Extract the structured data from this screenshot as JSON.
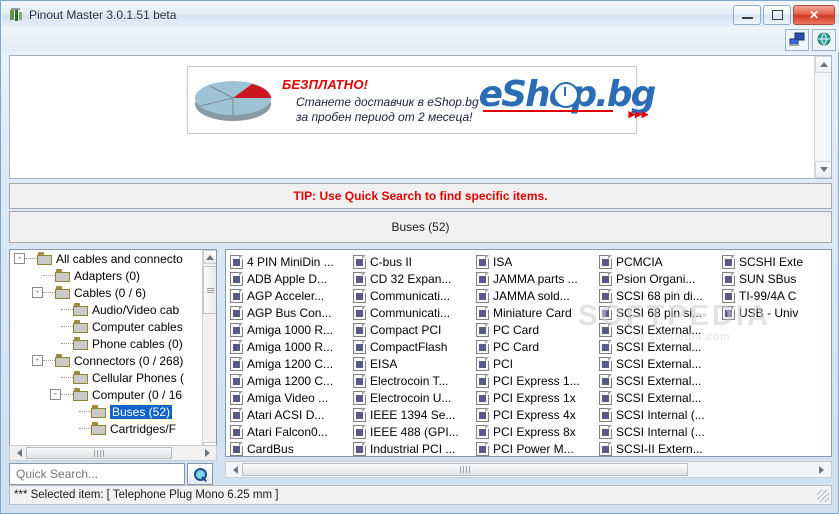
{
  "window": {
    "title": "Pinout Master 3.0.1.51 beta",
    "app_icon": "pinout-master-icon",
    "buttons": {
      "minimize": "—",
      "maximize": "□",
      "close": "✕"
    }
  },
  "toolbar": {
    "items": [
      {
        "icon": "network-screen-icon",
        "label": ""
      },
      {
        "icon": "globe-icon",
        "label": ""
      }
    ]
  },
  "banner": {
    "free_label": "БЕЗПЛАТНО!",
    "line1": "Станете доставчик в eShop.bg",
    "line2": "за пробен период от 2 месеца!",
    "logo_text": "eShop.bg",
    "arrow": "▸▸▸",
    "pie_icon": "pie-chart-icon"
  },
  "tip": {
    "text": "TIP: Use Quick Search to find specific items."
  },
  "header": {
    "title": "Buses (52)"
  },
  "tree": {
    "items": [
      {
        "label": "All cables and connecto",
        "indent": 0,
        "toggle": "-",
        "selected": false
      },
      {
        "label": "Adapters (0)",
        "indent": 1,
        "toggle": "",
        "selected": false
      },
      {
        "label": "Cables (0 / 6)",
        "indent": 1,
        "toggle": "-",
        "selected": false
      },
      {
        "label": "Audio/Video cab",
        "indent": 2,
        "toggle": "",
        "selected": false
      },
      {
        "label": "Computer cables",
        "indent": 2,
        "toggle": "",
        "selected": false
      },
      {
        "label": "Phone cables (0)",
        "indent": 2,
        "toggle": "",
        "selected": false
      },
      {
        "label": "Connectors (0 / 268)",
        "indent": 1,
        "toggle": "-",
        "selected": false
      },
      {
        "label": "Cellular Phones (",
        "indent": 2,
        "toggle": "",
        "selected": false
      },
      {
        "label": "Computer (0 / 16",
        "indent": 2,
        "toggle": "-",
        "selected": false
      },
      {
        "label": "Buses (52)",
        "indent": 3,
        "toggle": "",
        "selected": true
      },
      {
        "label": "Cartridges/F",
        "indent": 3,
        "toggle": "",
        "selected": false
      }
    ]
  },
  "search": {
    "value": "",
    "placeholder": "Quick Search...",
    "button_icon": "magnifier-icon"
  },
  "list": {
    "columns": [
      [
        "4 PIN MiniDin ...",
        "ADB Apple D...",
        "AGP Acceler...",
        "AGP Bus Con...",
        "Amiga 1000 R...",
        "Amiga 1000 R...",
        "Amiga 1200 C...",
        "Amiga 1200 C...",
        "Amiga Video ...",
        "Atari ACSI D...",
        "Atari Falcon0...",
        "CardBus"
      ],
      [
        "C-bus II",
        "CD 32 Expan...",
        "Communicati...",
        "Communicati...",
        "Compact PCI",
        "CompactFlash",
        "EISA",
        "Electrocoin T...",
        "Electrocoin U...",
        "IEEE 1394 Se...",
        "IEEE 488 (GPI...",
        "Industrial PCI ..."
      ],
      [
        "ISA",
        "JAMMA parts ...",
        "JAMMA sold...",
        "Miniature Card",
        "PC Card",
        "PC Card",
        "PCI",
        "PCI Express 1...",
        "PCI Express 1x",
        "PCI Express 4x",
        "PCI Express 8x",
        "PCI Power M..."
      ],
      [
        "PCMCIA",
        "Psion Organi...",
        "SCSI 68 pin di...",
        "SCSI 68 pin si...",
        "SCSI External...",
        "SCSI External...",
        "SCSI External...",
        "SCSI External...",
        "SCSI External...",
        "SCSI Internal (...",
        "SCSI Internal (...",
        "SCSI-II Extern..."
      ],
      [
        "SCSHI Exte",
        "SUN SBus",
        "TI-99/4A C",
        "USB - Univ"
      ]
    ]
  },
  "watermark": {
    "big": "SOFTPEDIA",
    "small": "www.softpedia.com"
  },
  "status": {
    "text": "*** Selected item: [ Telephone Plug Mono 6.25 mm ]"
  },
  "colors": {
    "accent_red": "#e00000",
    "selection_blue": "#1063c9",
    "window_border": "#7ba7d0"
  }
}
